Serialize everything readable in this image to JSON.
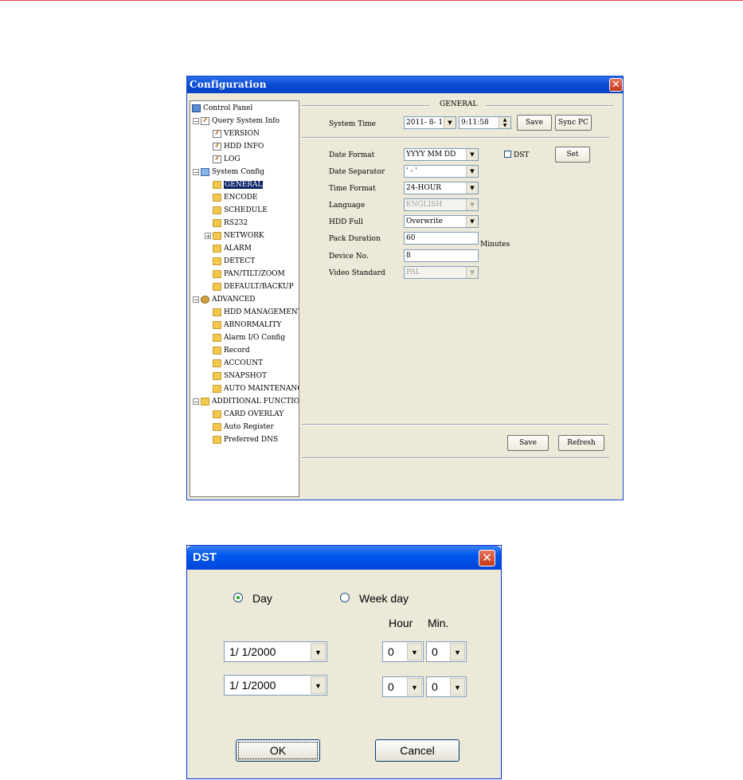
{
  "config_window": {
    "title": "Configuration",
    "tree": [
      {
        "label": "Control Panel",
        "icon": "monitor-icon"
      },
      {
        "label": "Query System Info",
        "icon": "document-icon"
      },
      {
        "label": "VERSION",
        "icon": "document-icon"
      },
      {
        "label": "HDD INFO",
        "icon": "document-icon"
      },
      {
        "label": "LOG",
        "icon": "document-icon"
      },
      {
        "label": "System Config",
        "icon": "tools-icon"
      },
      {
        "label": "GENERAL",
        "icon": "folder-open-icon",
        "selected": true
      },
      {
        "label": "ENCODE",
        "icon": "folder-icon"
      },
      {
        "label": "SCHEDULE",
        "icon": "folder-icon"
      },
      {
        "label": "RS232",
        "icon": "folder-icon"
      },
      {
        "label": "NETWORK",
        "icon": "folder-icon"
      },
      {
        "label": "ALARM",
        "icon": "folder-icon"
      },
      {
        "label": "DETECT",
        "icon": "folder-icon"
      },
      {
        "label": "PAN/TILT/ZOOM",
        "icon": "folder-icon"
      },
      {
        "label": "DEFAULT/BACKUP",
        "icon": "folder-icon"
      },
      {
        "label": "ADVANCED",
        "icon": "gear-icon"
      },
      {
        "label": "HDD MANAGEMENT",
        "icon": "folder-icon"
      },
      {
        "label": "ABNORMALITY",
        "icon": "folder-icon"
      },
      {
        "label": "Alarm I/O Config",
        "icon": "folder-icon"
      },
      {
        "label": "Record",
        "icon": "folder-icon"
      },
      {
        "label": "ACCOUNT",
        "icon": "folder-icon"
      },
      {
        "label": "SNAPSHOT",
        "icon": "folder-icon"
      },
      {
        "label": "AUTO MAINTENANCE",
        "icon": "folder-icon"
      },
      {
        "label": "ADDITIONAL FUNCTION",
        "icon": "folder-icon"
      },
      {
        "label": "CARD OVERLAY",
        "icon": "folder-icon"
      },
      {
        "label": "Auto Register",
        "icon": "folder-icon"
      },
      {
        "label": "Preferred DNS",
        "icon": "folder-icon"
      }
    ],
    "general": {
      "section_title": "GENERAL",
      "system_time_label": "System Time",
      "date_value": "2011- 8- 1",
      "time_value": "9:11:58",
      "save_time_label": "Save",
      "sync_pc_label": "Sync PC",
      "fields": {
        "date_format": {
          "label": "Date Format",
          "value": "YYYY MM DD"
        },
        "date_separator": {
          "label": "Date Separator",
          "value": "' - '"
        },
        "time_format": {
          "label": "Time Format",
          "value": "24-HOUR"
        },
        "language": {
          "label": "Language",
          "value": "ENGLISH"
        },
        "hdd_full": {
          "label": "HDD Full",
          "value": "Overwrite"
        },
        "pack_duration": {
          "label": "Pack Duration",
          "value": "60",
          "unit": "Minutes"
        },
        "device_no": {
          "label": "Device No.",
          "value": "8"
        },
        "video_standard": {
          "label": "Video Standard",
          "value": "PAL"
        }
      },
      "dst_label": "DST",
      "set_label": "Set",
      "save_label": "Save",
      "refresh_label": "Refresh"
    }
  },
  "dst_dialog": {
    "title": "DST",
    "day_label": "Day",
    "weekday_label": "Week day",
    "hour_header": "Hour",
    "min_header": "Min.",
    "start_date": "1/ 1/2000",
    "end_date": "1/ 1/2000",
    "start_hour": "0",
    "start_min": "0",
    "end_hour": "0",
    "end_min": "0",
    "ok_label": "OK",
    "cancel_label": "Cancel"
  }
}
